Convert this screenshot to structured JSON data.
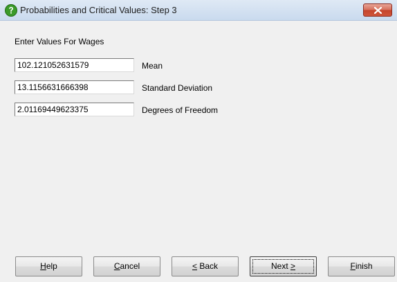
{
  "window": {
    "title": "Probabilities and Critical Values: Step 3",
    "title_icon": "question-icon",
    "close_icon": "close-icon"
  },
  "heading": "Enter Values For Wages",
  "fields": [
    {
      "value": "102.121052631579",
      "label": "Mean"
    },
    {
      "value": "13.1156631666398",
      "label": "Standard Deviation"
    },
    {
      "value": "2.01169449623375",
      "label": "Degrees of Freedom"
    }
  ],
  "buttons": {
    "help": {
      "prefix": "",
      "mnemonic": "H",
      "suffix": "elp"
    },
    "cancel": {
      "prefix": "",
      "mnemonic": "C",
      "suffix": "ancel"
    },
    "back": {
      "prefix": "",
      "mnemonic": "<",
      "suffix": " Back"
    },
    "next": {
      "prefix": "Next ",
      "mnemonic": ">",
      "suffix": ""
    },
    "finish": {
      "prefix": "",
      "mnemonic": "F",
      "suffix": "inish"
    }
  }
}
